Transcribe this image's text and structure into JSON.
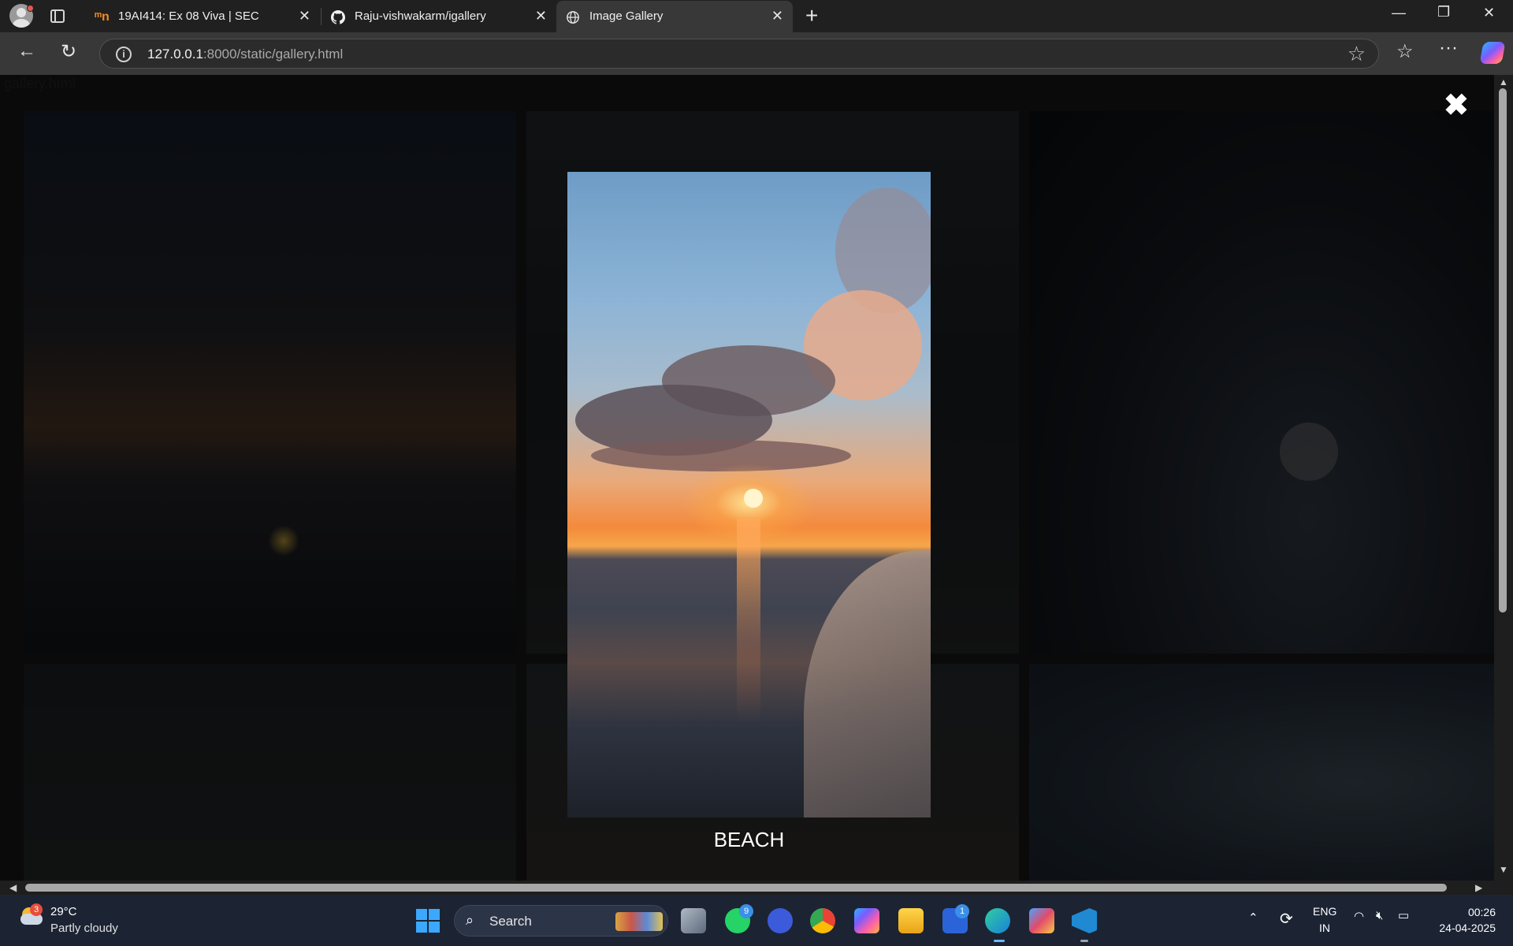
{
  "browser": {
    "tabs": [
      {
        "title": "19AI414: Ex 08 Viva | SEC",
        "favicon": "moodle-icon"
      },
      {
        "title": "Raju-vishwakarm/igallery",
        "favicon": "github-icon"
      },
      {
        "title": "Image Gallery",
        "favicon": "globe-icon",
        "active": true
      }
    ],
    "address": {
      "host": "127.0.0.1",
      "rest": ":8000/static/gallery.html"
    }
  },
  "page": {
    "filename": "gallery.html",
    "close_symbol": "✖",
    "lightbox_caption": "BEACH"
  },
  "taskbar": {
    "weather": {
      "temp": "29°C",
      "condition": "Partly cloudy",
      "badge": "3"
    },
    "search_label": "Search",
    "whatsapp_badge": "9",
    "teams_badge": "1",
    "language": {
      "line1": "ENG",
      "line2": "IN"
    },
    "time": "00:26",
    "date": "24-04-2025"
  },
  "colors": {
    "accent": "#3ba8ff",
    "tab_active": "#383838",
    "taskbar": "#1c2434"
  }
}
